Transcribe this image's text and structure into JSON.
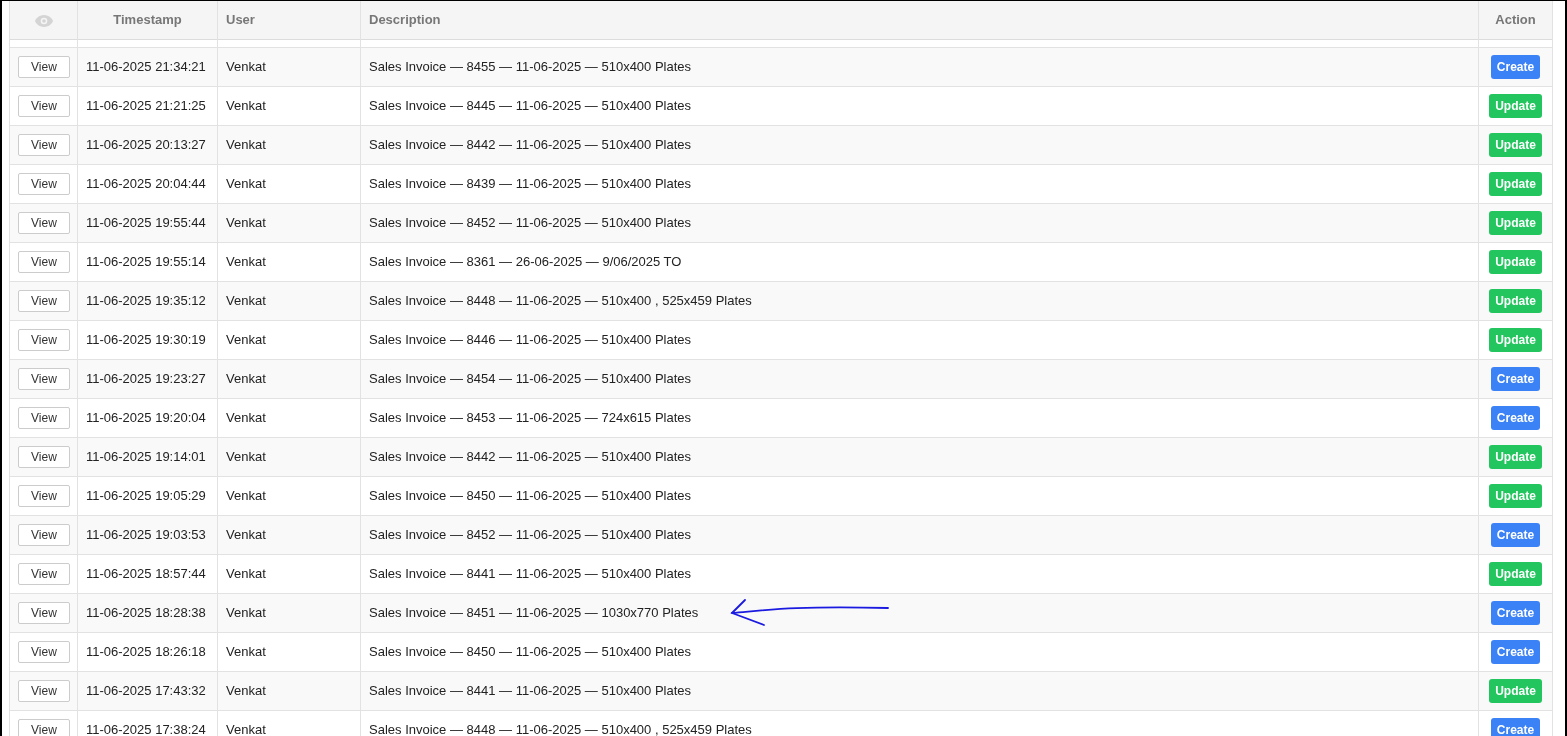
{
  "table": {
    "columns": [
      "Timestamp",
      "User",
      "Description",
      "Action"
    ],
    "rows": [
      {
        "view": "View",
        "timestamp": "11-06-2025 21:34:21",
        "user": "Venkat",
        "description": "Sales Invoice — 8455 — 11-06-2025 — 510x400 Plates",
        "action": {
          "kind": "create",
          "label": "Create"
        },
        "arrow": false
      },
      {
        "view": "View",
        "timestamp": "11-06-2025 21:21:25",
        "user": "Venkat",
        "description": "Sales Invoice — 8445 — 11-06-2025 — 510x400 Plates",
        "action": {
          "kind": "update",
          "label": "Update"
        },
        "arrow": false
      },
      {
        "view": "View",
        "timestamp": "11-06-2025 20:13:27",
        "user": "Venkat",
        "description": "Sales Invoice — 8442 — 11-06-2025 — 510x400 Plates",
        "action": {
          "kind": "update",
          "label": "Update"
        },
        "arrow": false
      },
      {
        "view": "View",
        "timestamp": "11-06-2025 20:04:44",
        "user": "Venkat",
        "description": "Sales Invoice — 8439 — 11-06-2025 — 510x400 Plates",
        "action": {
          "kind": "update",
          "label": "Update"
        },
        "arrow": false
      },
      {
        "view": "View",
        "timestamp": "11-06-2025 19:55:44",
        "user": "Venkat",
        "description": "Sales Invoice — 8452 — 11-06-2025 — 510x400 Plates",
        "action": {
          "kind": "update",
          "label": "Update"
        },
        "arrow": false
      },
      {
        "view": "View",
        "timestamp": "11-06-2025 19:55:14",
        "user": "Venkat",
        "description": "Sales Invoice — 8361 — 26-06-2025 — 9/06/2025 TO",
        "action": {
          "kind": "update",
          "label": "Update"
        },
        "arrow": false
      },
      {
        "view": "View",
        "timestamp": "11-06-2025 19:35:12",
        "user": "Venkat",
        "description": "Sales Invoice — 8448 — 11-06-2025 — 510x400 , 525x459 Plates",
        "action": {
          "kind": "update",
          "label": "Update"
        },
        "arrow": false
      },
      {
        "view": "View",
        "timestamp": "11-06-2025 19:30:19",
        "user": "Venkat",
        "description": "Sales Invoice — 8446 — 11-06-2025 — 510x400 Plates",
        "action": {
          "kind": "update",
          "label": "Update"
        },
        "arrow": false
      },
      {
        "view": "View",
        "timestamp": "11-06-2025 19:23:27",
        "user": "Venkat",
        "description": "Sales Invoice — 8454 — 11-06-2025 — 510x400 Plates",
        "action": {
          "kind": "create",
          "label": "Create"
        },
        "arrow": false
      },
      {
        "view": "View",
        "timestamp": "11-06-2025 19:20:04",
        "user": "Venkat",
        "description": "Sales Invoice — 8453 — 11-06-2025 — 724x615 Plates",
        "action": {
          "kind": "create",
          "label": "Create"
        },
        "arrow": false
      },
      {
        "view": "View",
        "timestamp": "11-06-2025 19:14:01",
        "user": "Venkat",
        "description": "Sales Invoice — 8442 — 11-06-2025 — 510x400 Plates",
        "action": {
          "kind": "update",
          "label": "Update"
        },
        "arrow": false
      },
      {
        "view": "View",
        "timestamp": "11-06-2025 19:05:29",
        "user": "Venkat",
        "description": "Sales Invoice — 8450 — 11-06-2025 — 510x400 Plates",
        "action": {
          "kind": "update",
          "label": "Update"
        },
        "arrow": false
      },
      {
        "view": "View",
        "timestamp": "11-06-2025 19:03:53",
        "user": "Venkat",
        "description": "Sales Invoice — 8452 — 11-06-2025 — 510x400 Plates",
        "action": {
          "kind": "create",
          "label": "Create"
        },
        "arrow": false
      },
      {
        "view": "View",
        "timestamp": "11-06-2025 18:57:44",
        "user": "Venkat",
        "description": "Sales Invoice — 8441 — 11-06-2025 — 510x400 Plates",
        "action": {
          "kind": "update",
          "label": "Update"
        },
        "arrow": false
      },
      {
        "view": "View",
        "timestamp": "11-06-2025 18:28:38",
        "user": "Venkat",
        "description": "Sales Invoice — 8451 — 11-06-2025 — 1030x770 Plates",
        "action": {
          "kind": "create",
          "label": "Create"
        },
        "arrow": true
      },
      {
        "view": "View",
        "timestamp": "11-06-2025 18:26:18",
        "user": "Venkat",
        "description": "Sales Invoice — 8450 — 11-06-2025 — 510x400 Plates",
        "action": {
          "kind": "create",
          "label": "Create"
        },
        "arrow": false
      },
      {
        "view": "View",
        "timestamp": "11-06-2025 17:43:32",
        "user": "Venkat",
        "description": "Sales Invoice — 8441 — 11-06-2025 — 510x400 Plates",
        "action": {
          "kind": "update",
          "label": "Update"
        },
        "arrow": false
      },
      {
        "view": "View",
        "timestamp": "11-06-2025 17:38:24",
        "user": "Venkat",
        "description": "Sales Invoice — 8448 — 11-06-2025 — 510x400 , 525x459 Plates",
        "action": {
          "kind": "create",
          "label": "Create"
        },
        "arrow": false
      }
    ]
  }
}
